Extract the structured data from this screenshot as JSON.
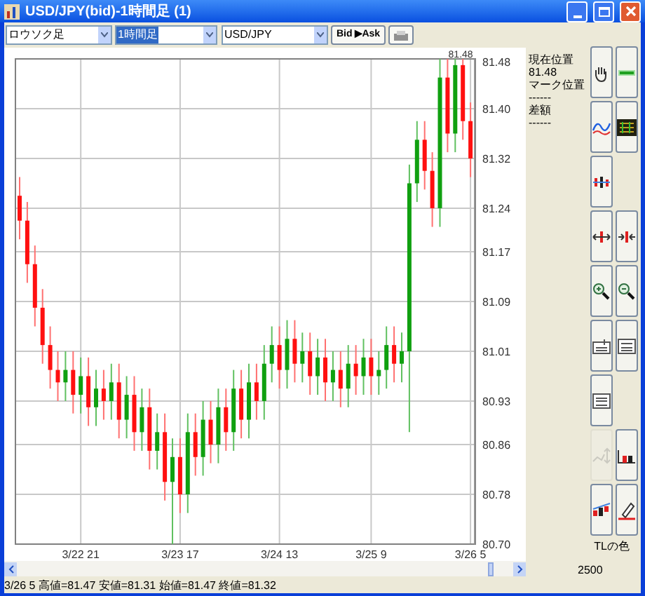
{
  "window": {
    "title": "USD/JPY(bid)-1時間足 (1)"
  },
  "toolbar": {
    "dropdowns": [
      {
        "value": "ロウソク足",
        "focused": false
      },
      {
        "value": "1時間足",
        "focused": true
      },
      {
        "value": "USD/JPY",
        "focused": false
      }
    ],
    "bid_ask_button": "Bid ▶Ask"
  },
  "chart": {
    "current_label": "81.48",
    "chart_data": {
      "type": "candlestick",
      "grid": true,
      "ylim": [
        80.7,
        81.48
      ],
      "yticks": [
        {
          "value": 81.48,
          "label": "81.48"
        },
        {
          "value": 81.4,
          "label": "81.40"
        },
        {
          "value": 81.32,
          "label": "81.32"
        },
        {
          "value": 81.24,
          "label": "81.24"
        },
        {
          "value": 81.17,
          "label": "81.17"
        },
        {
          "value": 81.09,
          "label": "81.09"
        },
        {
          "value": 81.01,
          "label": "81.01"
        },
        {
          "value": 80.93,
          "label": "80.93"
        },
        {
          "value": 80.86,
          "label": "80.86"
        },
        {
          "value": 80.78,
          "label": "80.78"
        },
        {
          "value": 80.7,
          "label": "80.70"
        }
      ],
      "categories": [
        null,
        null,
        null,
        null,
        null,
        null,
        null,
        null,
        "3/22 21",
        null,
        null,
        null,
        null,
        null,
        null,
        null,
        null,
        null,
        null,
        null,
        null,
        "3/23 17",
        null,
        null,
        null,
        null,
        null,
        null,
        null,
        null,
        null,
        null,
        null,
        null,
        "3/24 13",
        null,
        null,
        null,
        null,
        null,
        null,
        null,
        null,
        null,
        null,
        null,
        "3/25 9",
        null,
        null,
        null,
        null,
        null,
        null,
        null,
        null,
        null,
        null,
        null,
        null,
        "3/26 5"
      ],
      "ohlc": [
        [
          81.26,
          81.29,
          81.19,
          81.22
        ],
        [
          81.22,
          81.25,
          81.12,
          81.15
        ],
        [
          81.15,
          81.18,
          81.05,
          81.08
        ],
        [
          81.08,
          81.11,
          80.99,
          81.02
        ],
        [
          81.02,
          81.05,
          80.95,
          80.98
        ],
        [
          80.98,
          81.01,
          80.93,
          80.96
        ],
        [
          80.96,
          81.01,
          80.93,
          80.98
        ],
        [
          80.98,
          81.01,
          80.91,
          80.94
        ],
        [
          80.94,
          81.0,
          80.91,
          80.97
        ],
        [
          80.97,
          81.0,
          80.89,
          80.92
        ],
        [
          80.92,
          80.98,
          80.89,
          80.95
        ],
        [
          80.95,
          80.98,
          80.9,
          80.93
        ],
        [
          80.93,
          80.99,
          80.9,
          80.96
        ],
        [
          80.96,
          80.99,
          80.87,
          80.9
        ],
        [
          80.9,
          80.97,
          80.87,
          80.94
        ],
        [
          80.94,
          80.97,
          80.85,
          80.88
        ],
        [
          80.88,
          80.95,
          80.85,
          80.92
        ],
        [
          80.92,
          80.95,
          80.82,
          80.85
        ],
        [
          80.85,
          80.91,
          80.82,
          80.88
        ],
        [
          80.88,
          80.91,
          80.77,
          80.8
        ],
        [
          80.8,
          80.87,
          80.7,
          80.84
        ],
        [
          80.84,
          80.87,
          80.75,
          80.78
        ],
        [
          80.78,
          80.91,
          80.75,
          80.88
        ],
        [
          80.88,
          80.91,
          80.81,
          80.84
        ],
        [
          80.84,
          80.93,
          80.81,
          80.9
        ],
        [
          80.9,
          80.93,
          80.83,
          80.86
        ],
        [
          80.86,
          80.95,
          80.83,
          80.92
        ],
        [
          80.92,
          80.95,
          80.85,
          80.88
        ],
        [
          80.88,
          80.98,
          80.85,
          80.95
        ],
        [
          80.95,
          80.98,
          80.87,
          80.9
        ],
        [
          80.9,
          80.99,
          80.87,
          80.96
        ],
        [
          80.96,
          80.99,
          80.9,
          80.93
        ],
        [
          80.93,
          81.02,
          80.9,
          80.99
        ],
        [
          80.99,
          81.05,
          80.96,
          81.02
        ],
        [
          81.02,
          81.05,
          80.95,
          80.98
        ],
        [
          80.98,
          81.06,
          80.95,
          81.03
        ],
        [
          81.03,
          81.06,
          80.96,
          80.99
        ],
        [
          80.99,
          81.04,
          80.96,
          81.01
        ],
        [
          81.01,
          81.04,
          80.94,
          80.97
        ],
        [
          80.97,
          81.03,
          80.94,
          81.0
        ],
        [
          81.0,
          81.03,
          80.93,
          80.96
        ],
        [
          80.96,
          81.01,
          80.93,
          80.98
        ],
        [
          80.98,
          81.01,
          80.92,
          80.95
        ],
        [
          80.95,
          81.02,
          80.92,
          80.99
        ],
        [
          80.99,
          81.02,
          80.94,
          80.97
        ],
        [
          80.97,
          81.03,
          80.94,
          81.0
        ],
        [
          81.0,
          81.03,
          80.94,
          80.97
        ],
        [
          80.97,
          81.01,
          80.94,
          80.98
        ],
        [
          80.98,
          81.05,
          80.95,
          81.02
        ],
        [
          81.02,
          81.05,
          80.96,
          80.99
        ],
        [
          80.99,
          81.04,
          80.96,
          81.01
        ],
        [
          81.01,
          81.31,
          80.88,
          81.28
        ],
        [
          81.28,
          81.38,
          81.25,
          81.35
        ],
        [
          81.35,
          81.38,
          81.27,
          81.3
        ],
        [
          81.3,
          81.33,
          81.21,
          81.24
        ],
        [
          81.24,
          81.48,
          81.21,
          81.45
        ],
        [
          81.45,
          81.48,
          81.33,
          81.36
        ],
        [
          81.36,
          81.48,
          81.33,
          81.47
        ],
        [
          81.47,
          81.48,
          81.35,
          81.38
        ],
        [
          81.38,
          81.41,
          81.29,
          81.32
        ]
      ]
    }
  },
  "info": [
    "現在位置",
    "81.48",
    "マーク位置",
    "------",
    "差額",
    "------"
  ],
  "tools": [
    {
      "kind": "hand",
      "disabled": false
    },
    {
      "kind": "news",
      "disabled": false
    },
    {
      "kind": "wave",
      "disabled": false
    },
    {
      "kind": "matrix",
      "disabled": false
    },
    {
      "kind": "candles",
      "disabled": false
    },
    {
      "kind": "empty"
    },
    {
      "kind": "expand",
      "disabled": false
    },
    {
      "kind": "shrink",
      "disabled": false
    },
    {
      "kind": "zoom_in",
      "disabled": false
    },
    {
      "kind": "zoom_out",
      "disabled": false
    },
    {
      "kind": "fix",
      "disabled": false
    },
    {
      "kind": "fix2",
      "disabled": false
    },
    {
      "kind": "realfix",
      "disabled": false
    },
    {
      "kind": "empty"
    },
    {
      "kind": "scale",
      "disabled": true
    },
    {
      "kind": "bars",
      "disabled": false
    },
    {
      "kind": "trend",
      "disabled": false
    },
    {
      "kind": "pencil",
      "disabled": false
    }
  ],
  "color_label": "TLの色",
  "count": "2500",
  "status_bar": "3/26 5  高値=81.47 安値=81.31 始値=81.47 終値=81.32"
}
